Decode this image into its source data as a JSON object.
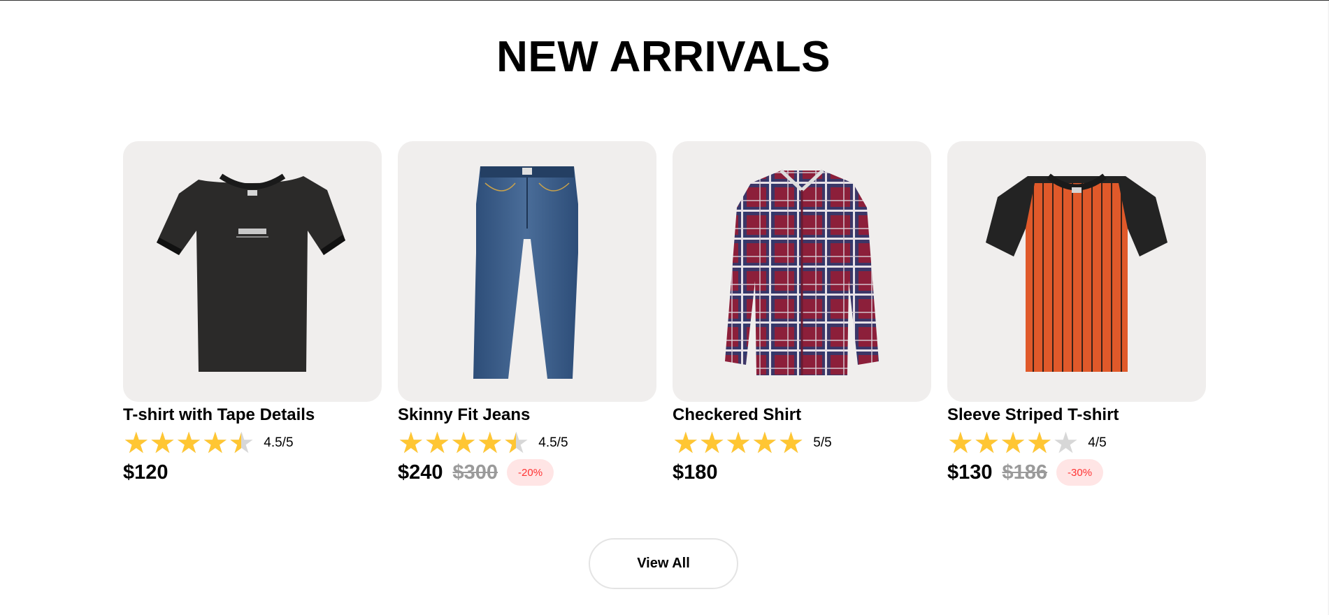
{
  "section": {
    "title": "NEW ARRIVALS",
    "view_all_label": "View All"
  },
  "colors": {
    "card_background": "#f0eeed",
    "star_filled": "#ffc633",
    "star_empty": "#d7d7d7",
    "discount_background": "#ffe5e5",
    "discount_text": "#ff3333"
  },
  "products": [
    {
      "name": "T-shirt with Tape Details",
      "image_icon": "black-tshirt-image",
      "rating": 4.5,
      "rating_text": "4.5/5",
      "price": "$120",
      "old_price": "",
      "discount": ""
    },
    {
      "name": "Skinny Fit Jeans",
      "image_icon": "blue-jeans-image",
      "rating": 4.5,
      "rating_text": "4.5/5",
      "price": "$240",
      "old_price": "$300",
      "discount": "-20%"
    },
    {
      "name": "Checkered Shirt",
      "image_icon": "checkered-shirt-image",
      "rating": 5,
      "rating_text": "5/5",
      "price": "$180",
      "old_price": "",
      "discount": ""
    },
    {
      "name": "Sleeve Striped T-shirt",
      "image_icon": "striped-tshirt-image",
      "rating": 4,
      "rating_text": "4/5",
      "price": "$130",
      "old_price": "$186",
      "discount": "-30%"
    }
  ]
}
